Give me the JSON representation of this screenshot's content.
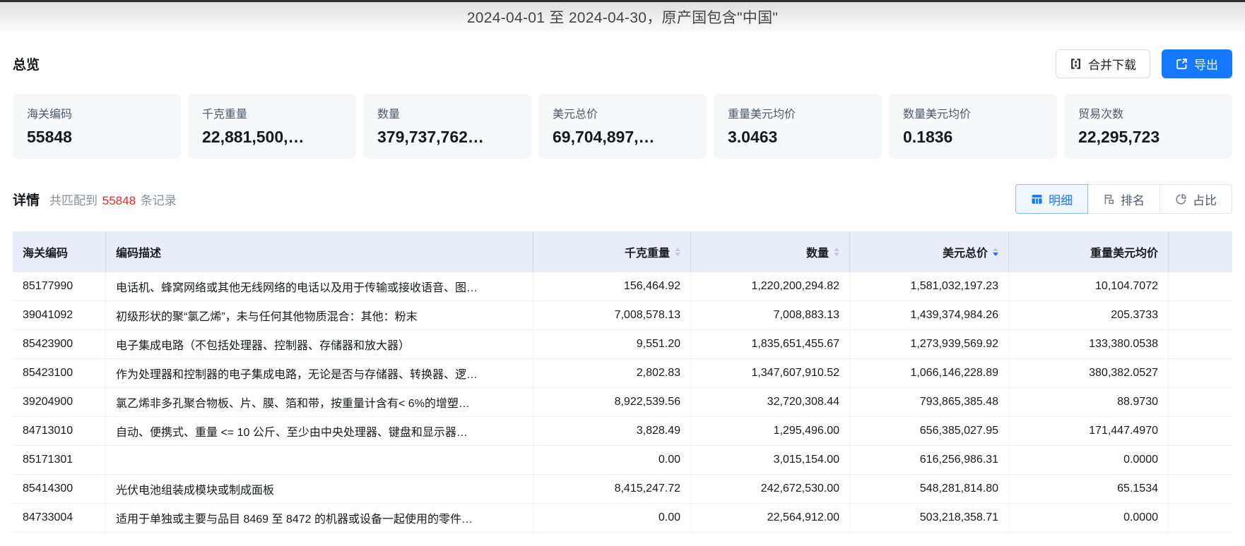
{
  "banner": {
    "title": "2024-04-01 至 2024-04-30，原产国包含\"中国\""
  },
  "overview": {
    "heading": "总览",
    "merge_download_label": "合并下载",
    "export_label": "导出",
    "cards": [
      {
        "label": "海关编码",
        "value": "55848"
      },
      {
        "label": "千克重量",
        "value": "22,881,500,…"
      },
      {
        "label": "数量",
        "value": "379,737,762…"
      },
      {
        "label": "美元总价",
        "value": "69,704,897,…"
      },
      {
        "label": "重量美元均价",
        "value": "3.0463"
      },
      {
        "label": "数量美元均价",
        "value": "0.1836"
      },
      {
        "label": "贸易次数",
        "value": "22,295,723"
      }
    ]
  },
  "detail": {
    "heading": "详情",
    "match_prefix": "共匹配到",
    "match_count": "55848",
    "match_suffix": "条记录",
    "tabs": [
      {
        "label": "明细",
        "icon": "table-icon",
        "active": true
      },
      {
        "label": "排名",
        "icon": "ranking-icon",
        "active": false
      },
      {
        "label": "占比",
        "icon": "pie-icon",
        "active": false
      }
    ]
  },
  "table": {
    "columns": [
      {
        "label": "海关编码",
        "align": "left",
        "sortable": false,
        "sort": "none"
      },
      {
        "label": "编码描述",
        "align": "left",
        "sortable": false,
        "sort": "none"
      },
      {
        "label": "千克重量",
        "align": "right",
        "sortable": true,
        "sort": "none"
      },
      {
        "label": "数量",
        "align": "right",
        "sortable": true,
        "sort": "none"
      },
      {
        "label": "美元总价",
        "align": "right",
        "sortable": true,
        "sort": "desc"
      },
      {
        "label": "重量美元均价",
        "align": "right",
        "sortable": false,
        "sort": "none"
      }
    ],
    "rows": [
      [
        "85177990",
        "电话机、蜂窝网络或其他无线网络的电话以及用于传输或接收语音、图…",
        "156,464.92",
        "1,220,200,294.82",
        "1,581,032,197.23",
        "10,104.7072"
      ],
      [
        "39041092",
        "初级形状的聚“氯乙烯”，未与任何其他物质混合：其他：粉末",
        "7,008,578.13",
        "7,008,883.13",
        "1,439,374,984.26",
        "205.3733"
      ],
      [
        "85423900",
        "电子集成电路（不包括处理器、控制器、存储器和放大器）",
        "9,551.20",
        "1,835,651,455.67",
        "1,273,939,569.92",
        "133,380.0538"
      ],
      [
        "85423100",
        "作为处理器和控制器的电子集成电路，无论是否与存储器、转换器、逻…",
        "2,802.83",
        "1,347,607,910.52",
        "1,066,146,228.89",
        "380,382.0527"
      ],
      [
        "39204900",
        "氯乙烯非多孔聚合物板、片、膜、箔和带，按重量计含有< 6%的增塑…",
        "8,922,539.56",
        "32,720,308.44",
        "793,865,385.48",
        "88.9730"
      ],
      [
        "84713010",
        "自动、便携式、重量 <= 10 公斤、至少由中央处理器、键盘和显示器…",
        "3,828.49",
        "1,295,496.00",
        "656,385,027.95",
        "171,447.4970"
      ],
      [
        "85171301",
        "",
        "0.00",
        "3,015,154.00",
        "616,256,986.31",
        "0.0000"
      ],
      [
        "85414300",
        "光伏电池组装成模块或制成面板",
        "8,415,247.72",
        "242,672,530.00",
        "548,281,814.80",
        "65.1534"
      ],
      [
        "84733004",
        "适用于单独或主要与品目 8469 至 8472 的机器或设备一起使用的零件…",
        "0.00",
        "22,564,912.00",
        "503,218,358.71",
        "0.0000"
      ]
    ]
  },
  "colors": {
    "accent": "#1677ff",
    "count_red": "#f5222d",
    "header_bg": "#e9edf7"
  }
}
